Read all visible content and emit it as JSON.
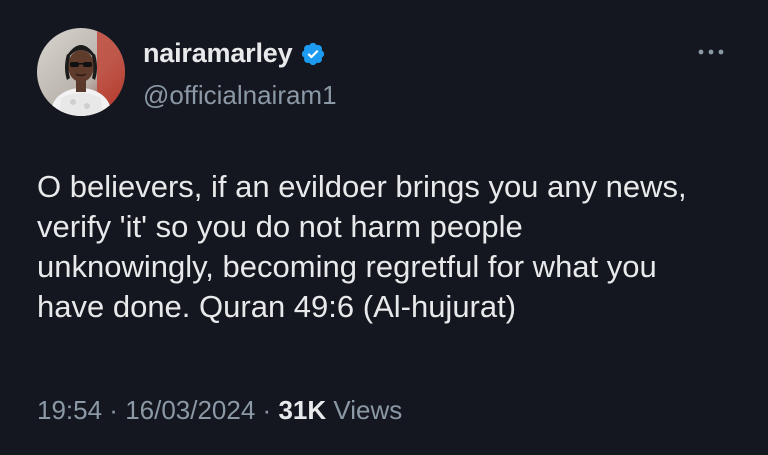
{
  "user": {
    "display_name": "nairamarley",
    "handle": "@officialnairam1",
    "verified": true,
    "avatar_icon": "profile-photo",
    "verified_color": "#1d9bf0"
  },
  "menu": {
    "more_icon": "more-horizontal-icon"
  },
  "tweet": {
    "lines": [
      "O believers, if an evildoer brings you any news,",
      "verify 'it' so you do not harm people",
      "unknowingly, becoming regretful for what you",
      "have done. Quran 49:6 (Al-hujurat)"
    ]
  },
  "meta": {
    "time": "19:54",
    "separator": " · ",
    "date": "16/03/2024",
    "views_count": "31K",
    "views_label": " Views"
  },
  "colors": {
    "background": "#14171f",
    "text": "#e7e9ea",
    "secondary": "#8b98a5"
  }
}
